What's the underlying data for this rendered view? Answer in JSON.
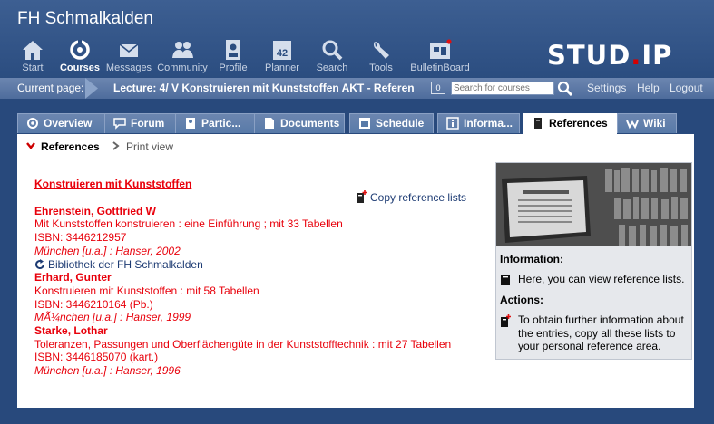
{
  "site": {
    "title": "FH Schmalkalden",
    "logo_main": "STUD",
    "logo_dot": ".",
    "logo_end": "IP"
  },
  "nav": [
    {
      "label": "Start",
      "icon": "home-icon",
      "active": false
    },
    {
      "label": "Courses",
      "icon": "courses-icon",
      "active": true
    },
    {
      "label": "Messages",
      "icon": "envelope-icon",
      "active": false
    },
    {
      "label": "Community",
      "icon": "community-icon",
      "active": false
    },
    {
      "label": "Profile",
      "icon": "profile-icon",
      "active": false
    },
    {
      "label": "Planner",
      "icon": "calendar-icon",
      "active": false,
      "badge": "42"
    },
    {
      "label": "Search",
      "icon": "search-icon",
      "active": false
    },
    {
      "label": "Tools",
      "icon": "wrench-icon",
      "active": false
    },
    {
      "label": "BulletinBoard",
      "icon": "bulletin-board-icon",
      "active": false
    }
  ],
  "locbar": {
    "label": "Current page:",
    "title": "Lecture: 4/ V Konstruieren mit Kunststoffen AKT - References",
    "count": "0",
    "search_placeholder": "Search for courses",
    "links": [
      "Settings",
      "Help",
      "Logout"
    ]
  },
  "tabs": [
    {
      "label": "Overview",
      "icon": "overview-icon",
      "active": false
    },
    {
      "label": "Forum",
      "icon": "forum-icon",
      "active": false
    },
    {
      "label": "Partic...",
      "icon": "participants-icon",
      "active": false
    },
    {
      "label": "Documents",
      "icon": "documents-icon",
      "active": false
    },
    {
      "label": "Schedule",
      "icon": "schedule-icon",
      "active": false
    },
    {
      "label": "Informa...",
      "icon": "information-icon",
      "active": false
    },
    {
      "label": "References",
      "icon": "book-icon",
      "active": true
    },
    {
      "label": "Wiki",
      "icon": "wiki-icon",
      "active": false
    }
  ],
  "subnav": {
    "references": "References",
    "print_view": "Print view"
  },
  "references": {
    "list_title": "Konstruieren mit Kunststoffen",
    "copy_link": "Copy reference lists",
    "entries": [
      {
        "author": "Ehrenstein, Gottfried W",
        "title": "Mit Kunststoffen konstruieren : eine Einführung ; mit 33 Tabellen",
        "isbn": "ISBN: 3446212957",
        "publisher": "München [u.a.] : Hanser, 2002",
        "library": "Bibliothek der FH Schmalkalden"
      },
      {
        "author": "Erhard, Gunter",
        "title": "Konstruieren mit Kunststoffen : mit 58 Tabellen",
        "isbn": "ISBN: 3446210164 (Pb.)",
        "publisher": "MÃ¼nchen [u.a.] : Hanser, 1999"
      },
      {
        "author": "Starke, Lothar",
        "title": "Toleranzen, Passungen und Oberflächengüte in der Kunststofftechnik : mit 27 Tabellen",
        "isbn": "ISBN: 3446185070 (kart.)",
        "publisher": "München [u.a.] : Hanser, 1996"
      }
    ]
  },
  "infobox": {
    "information_heading": "Information:",
    "information_text": "Here, you can view reference lists.",
    "actions_heading": "Actions:",
    "actions_text": "To obtain further information about the entries, copy all these lists to your personal reference area."
  },
  "colors": {
    "header": "#2b4d80",
    "accent_red": "#e8000b",
    "link_blue": "#1d3b73"
  }
}
